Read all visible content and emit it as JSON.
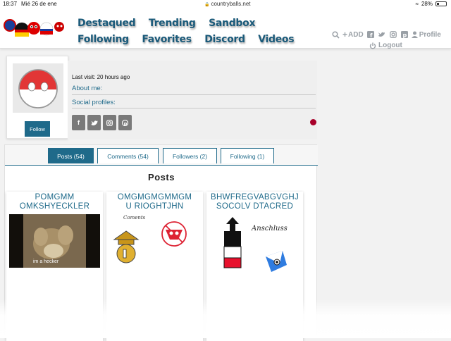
{
  "status": {
    "time": "18:37",
    "date": "Mié 26 de ene",
    "url": "countryballs.net",
    "battery": "28%",
    "battery_level": 0.28
  },
  "nav": {
    "links": [
      "Destaqued",
      "Trending",
      "Sandbox",
      "Following",
      "Favorites",
      "Discord",
      "Videos"
    ],
    "add_label": "ADD",
    "profile_label": "Profile",
    "logout_label": "Logout"
  },
  "profile": {
    "last_visit": "Last visit: 20 hours ago",
    "about_heading": "About me:",
    "social_heading": "Social profiles:",
    "follow_label": "Follow",
    "socials": [
      "facebook-icon",
      "twitter-icon",
      "instagram-icon",
      "pinterest-icon"
    ],
    "status_dot_color": "#a8002a"
  },
  "tabs": [
    {
      "label": "Posts (54)",
      "active": true
    },
    {
      "label": "Comments (54)",
      "active": false
    },
    {
      "label": "Followers (2)",
      "active": false
    },
    {
      "label": "Following (1)",
      "active": false
    }
  ],
  "posts_title": "Posts",
  "posts": [
    {
      "title_line1": "POMGMM",
      "title_line2": "OMKSHYECKLER",
      "caption": "im a hecker"
    },
    {
      "title_line1": "OMGMGMGMMGM",
      "title_line2": "U RIOGHTJHN",
      "caption": "Coments"
    },
    {
      "title_line1": "BHWFREGVABGVGHJ",
      "title_line2": "SOCOLV DTACRED",
      "caption": "Anschluss"
    }
  ],
  "colors": {
    "accent": "#1f6a8a",
    "nav_text": "#1a5a7a"
  }
}
